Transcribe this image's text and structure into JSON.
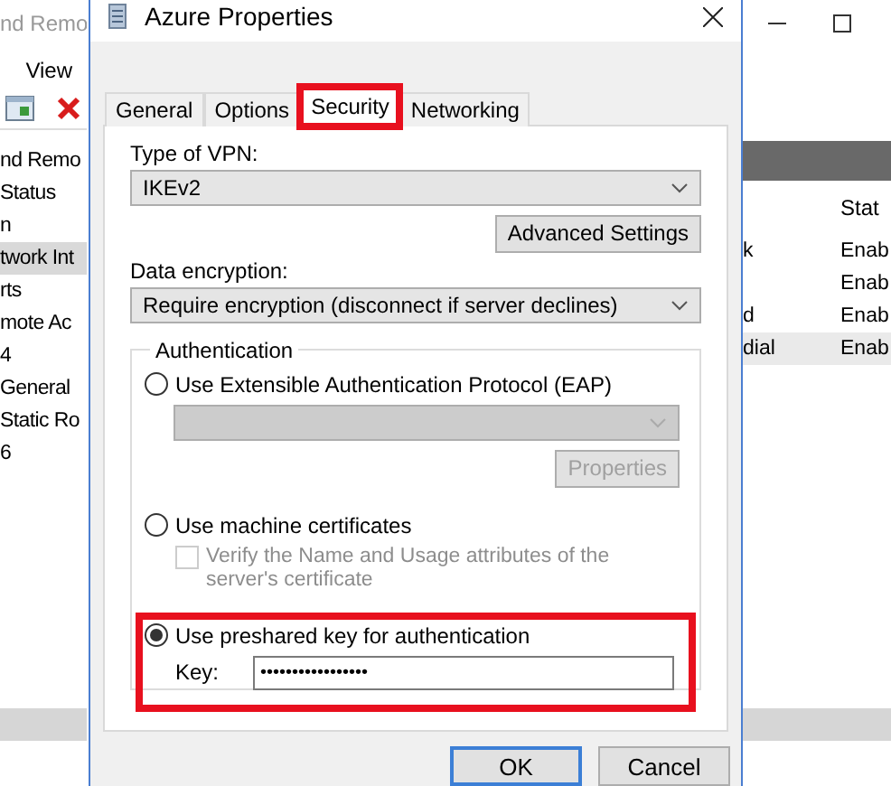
{
  "background_window": {
    "title": "nd Remo",
    "menu": [
      "View"
    ],
    "tree": [
      {
        "label": "nd Remo",
        "selected": false
      },
      {
        "label": "Status",
        "selected": false
      },
      {
        "label": "n",
        "selected": false
      },
      {
        "label": "twork Int",
        "selected": true
      },
      {
        "label": "rts",
        "selected": false
      },
      {
        "label": "mote Ac",
        "selected": false
      },
      {
        "label": "4",
        "selected": false
      },
      {
        "label": "General",
        "selected": false
      },
      {
        "label": "Static Ro",
        "selected": false
      },
      {
        "label": "6",
        "selected": false
      }
    ],
    "list": {
      "column_2": "Stat",
      "rows": [
        {
          "column_1": "k",
          "column_2": "Enab",
          "selected": false
        },
        {
          "column_1": "",
          "column_2": "Enab",
          "selected": false
        },
        {
          "column_1": "d",
          "column_2": "Enab",
          "selected": false
        },
        {
          "column_1": "dial",
          "column_2": "Enab",
          "selected": true
        }
      ]
    }
  },
  "dialog": {
    "title": "Azure Properties",
    "tabs": [
      {
        "label": "General",
        "selected": false,
        "highlighted": false
      },
      {
        "label": "Options",
        "selected": false,
        "highlighted": false
      },
      {
        "label": "Security",
        "selected": true,
        "highlighted": true
      },
      {
        "label": "Networking",
        "selected": false,
        "highlighted": false
      }
    ],
    "vpn_type": {
      "label": "Type of VPN:",
      "value": "IKEv2"
    },
    "advanced_button": "Advanced Settings",
    "encryption": {
      "label": "Data encryption:",
      "value": "Require encryption (disconnect if server declines)"
    },
    "authentication": {
      "title": "Authentication",
      "options": [
        {
          "kind": "eap",
          "label": "Use Extensible Authentication Protocol (EAP)",
          "selected": false,
          "highlighted": false,
          "properties_button": {
            "label": "Properties",
            "disabled": true
          }
        },
        {
          "kind": "certificate",
          "label": "Use machine certificates",
          "selected": false,
          "highlighted": false,
          "checkbox": {
            "label": "Verify the Name and Usage attributes of the server's certificate",
            "checked": false,
            "disabled": true
          }
        },
        {
          "kind": "preshared",
          "label": "Use preshared key for authentication",
          "selected": true,
          "highlighted": true,
          "key": {
            "label": "Key:",
            "value": "•••••••••••••••••"
          }
        }
      ]
    },
    "buttons": [
      {
        "label": "OK",
        "default": true
      },
      {
        "label": "Cancel",
        "default": false
      }
    ]
  }
}
